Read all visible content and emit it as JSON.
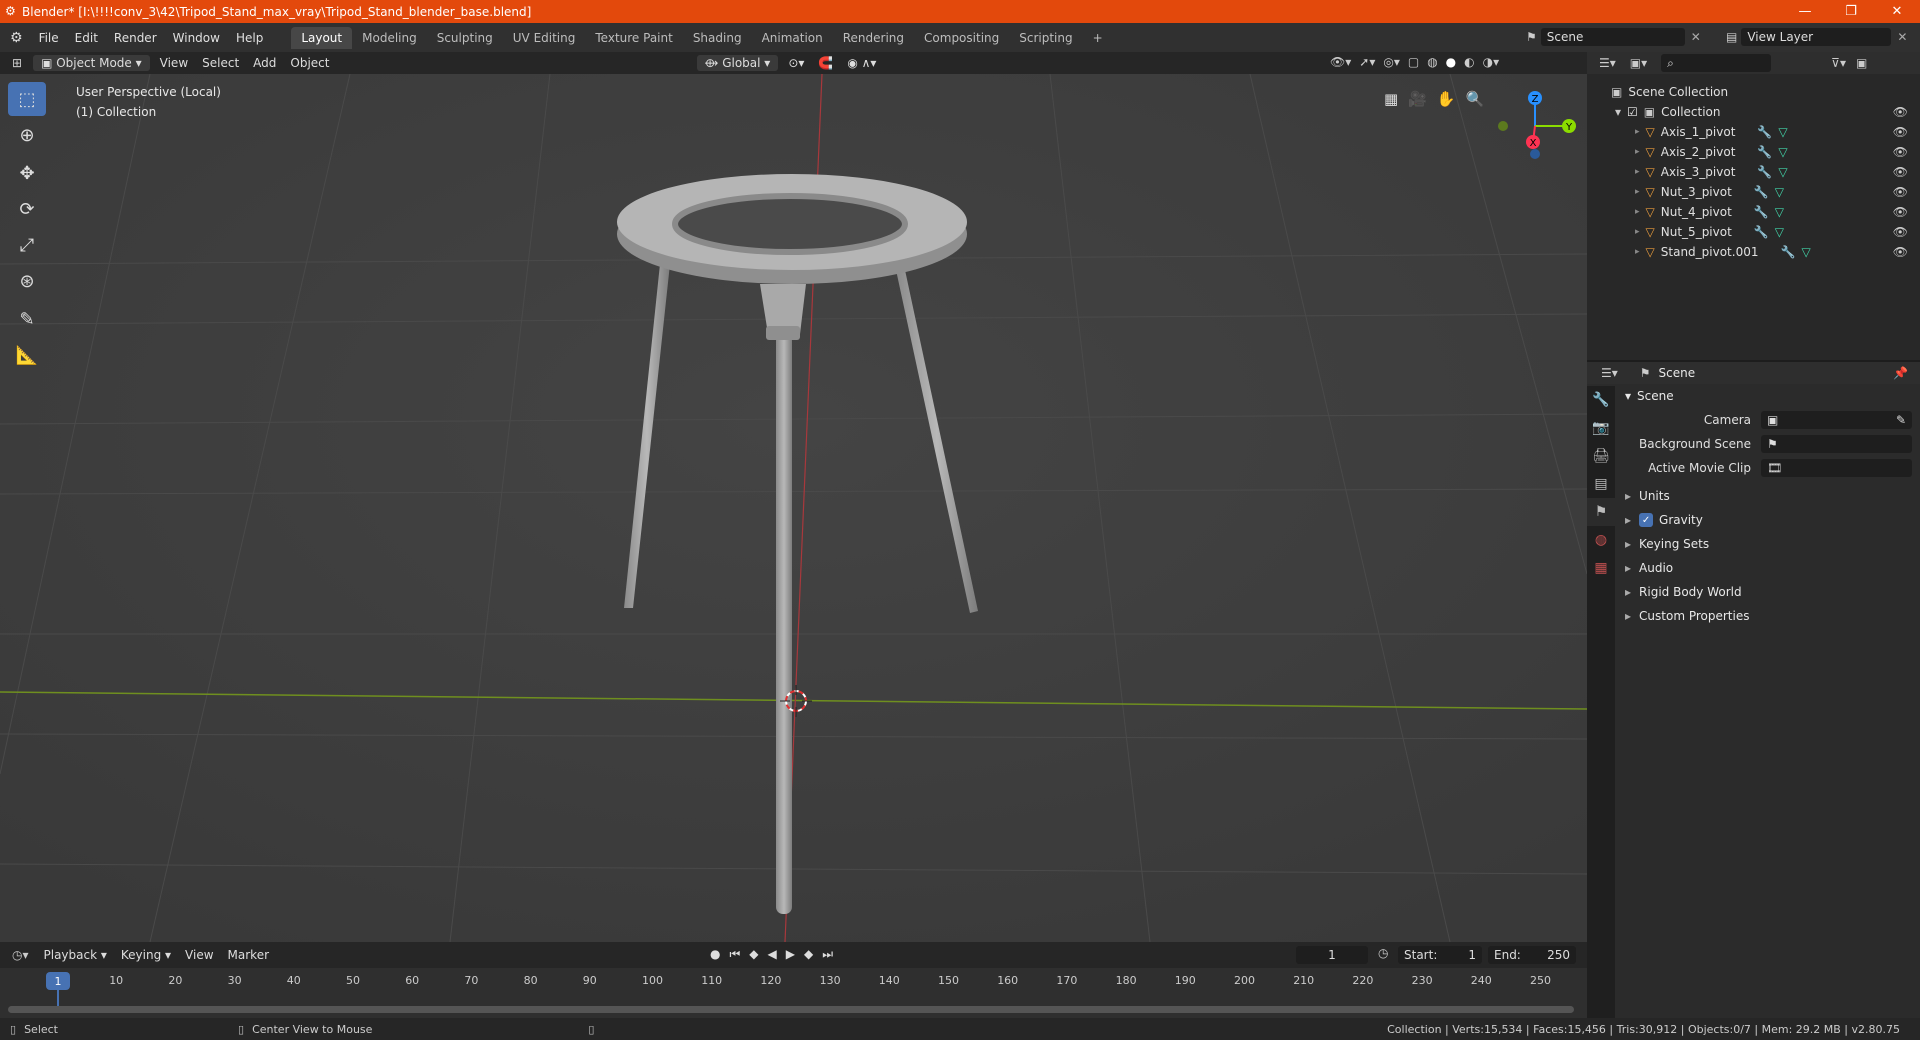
{
  "window": {
    "title": "Blender* [I:\\!!!!conv_3\\42\\Tripod_Stand_max_vray\\Tripod_Stand_blender_base.blend]"
  },
  "menu": [
    "File",
    "Edit",
    "Render",
    "Window",
    "Help"
  ],
  "workspaces": [
    "Layout",
    "Modeling",
    "Sculpting",
    "UV Editing",
    "Texture Paint",
    "Shading",
    "Animation",
    "Rendering",
    "Compositing",
    "Scripting"
  ],
  "active_workspace": "Layout",
  "scene_field": "Scene",
  "view_layer_field": "View Layer",
  "viewport_header": {
    "mode": "Object Mode",
    "menus": [
      "View",
      "Select",
      "Add",
      "Object"
    ],
    "transform": "Global"
  },
  "viewport": {
    "perspective": "User Perspective (Local)",
    "collection": "(1) Collection"
  },
  "gizmo": {
    "z": "Z",
    "y": "Y",
    "x": "X"
  },
  "outliner": {
    "root": "Scene Collection",
    "collection": "Collection",
    "items": [
      "Axis_1_pivot",
      "Axis_2_pivot",
      "Axis_3_pivot",
      "Nut_3_pivot",
      "Nut_4_pivot",
      "Nut_5_pivot",
      "Stand_pivot.001"
    ]
  },
  "properties": {
    "context": "Scene",
    "panel": "Scene",
    "fields": [
      {
        "label": "Camera"
      },
      {
        "label": "Background Scene"
      },
      {
        "label": "Active Movie Clip"
      }
    ],
    "subpanels": [
      "Units",
      "Gravity",
      "Keying Sets",
      "Audio",
      "Rigid Body World",
      "Custom Properties"
    ],
    "gravity_checked": true
  },
  "timeline": {
    "menus": [
      "Playback",
      "Keying",
      "View",
      "Marker"
    ],
    "current_frame": "1",
    "start_label": "Start:",
    "start": "1",
    "end_label": "End:",
    "end": "250",
    "ruler": [
      "10",
      "20",
      "30",
      "40",
      "50",
      "60",
      "70",
      "80",
      "90",
      "100",
      "110",
      "120",
      "130",
      "140",
      "150",
      "160",
      "170",
      "180",
      "190",
      "200",
      "210",
      "220",
      "230",
      "240",
      "250"
    ],
    "playhead_label": "1"
  },
  "statusbar": {
    "select": "Select",
    "center": "Center View to Mouse",
    "stats": "Collection | Verts:15,534 | Faces:15,456 | Tris:30,912 | Objects:0/7 | Mem: 29.2 MB | v2.80.75"
  },
  "colors": {
    "titlebar": "#e3490c",
    "active_blue": "#4772b3",
    "x_axis": "#ff3352",
    "y_axis": "#8bdc00",
    "z_axis": "#2890ff",
    "object_orange": "#e69a3c"
  }
}
